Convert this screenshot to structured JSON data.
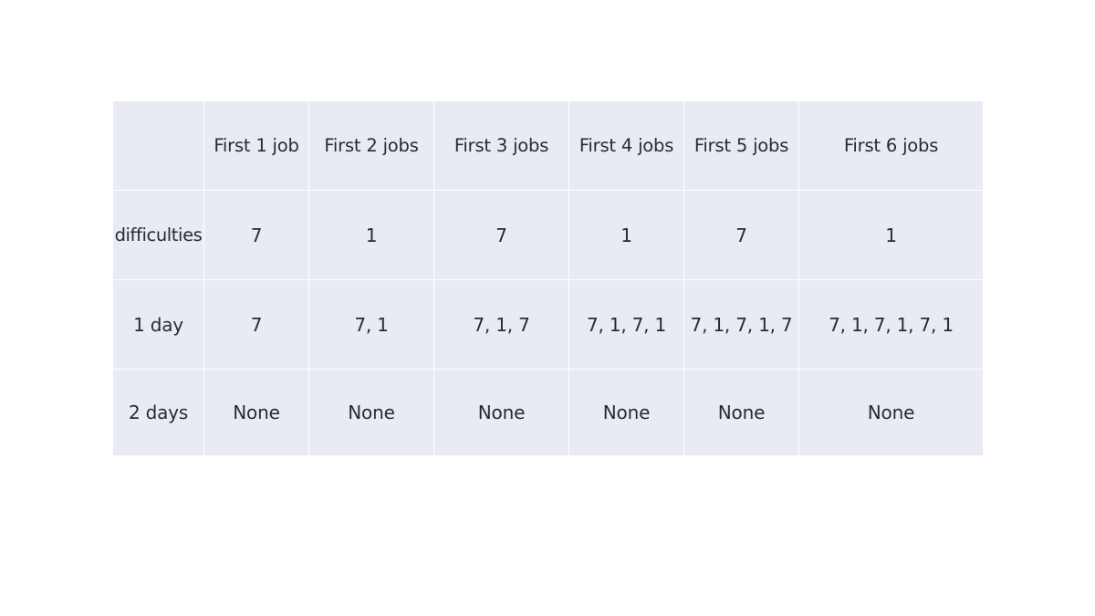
{
  "table": {
    "header": {
      "corner": "",
      "columns": [
        "First 1 job",
        "First 2 jobs",
        "First 3 jobs",
        "First 4 jobs",
        "First 5 jobs",
        "First 6 jobs"
      ]
    },
    "rows": [
      {
        "label": "difficulties",
        "cells": [
          "7",
          "1",
          "7",
          "1",
          "7",
          "1"
        ]
      },
      {
        "label": "1 day",
        "cells": [
          "7",
          "7, 1",
          "7, 1, 7",
          "7, 1, 7, 1",
          "7, 1, 7, 1, 7",
          "7, 1, 7, 1, 7, 1"
        ]
      },
      {
        "label": "2 days",
        "cells": [
          "None",
          "None",
          "None",
          "None",
          "None",
          "None"
        ]
      }
    ]
  },
  "colors": {
    "cell_background": "#e8ebf4",
    "grid_lines": "#ffffff",
    "text": "#2b2b2b"
  }
}
